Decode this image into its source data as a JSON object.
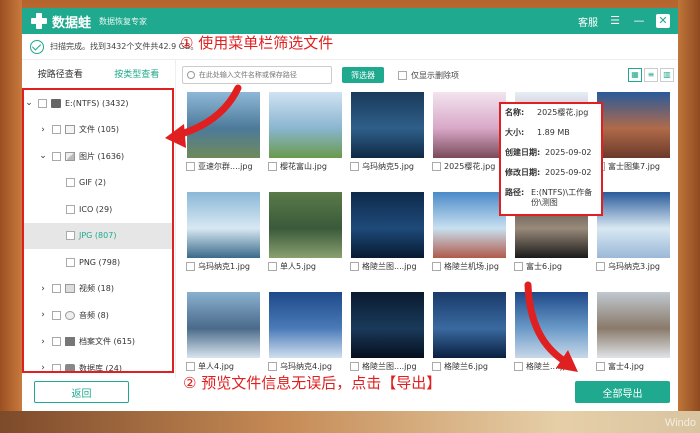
{
  "app": {
    "name": "数据蛙",
    "subtitle": "数据恢复专家",
    "support": "客服"
  },
  "status": {
    "text": "扫描完成。找到3432个文件共42.9 GB。"
  },
  "annotations": {
    "step1": "① 使用菜单栏筛选文件",
    "step2": "② 预览文件信息无误后，点击【导出】"
  },
  "sidebar": {
    "tabs": [
      {
        "label": "按路径查看"
      },
      {
        "label": "按类型查看"
      }
    ],
    "tree": [
      {
        "label": "E:(NTFS) (3432)"
      },
      {
        "label": "文件 (105)"
      },
      {
        "label": "图片 (1636)"
      },
      {
        "label": "GIF (2)"
      },
      {
        "label": "ICO (29)"
      },
      {
        "label": "JPG (807)"
      },
      {
        "label": "PNG (798)"
      },
      {
        "label": "视频 (18)"
      },
      {
        "label": "音频 (8)"
      },
      {
        "label": "档案文件 (615)"
      },
      {
        "label": "数据库 (24)"
      }
    ]
  },
  "toolbar": {
    "search_placeholder": "在此处输入文件名称或保存路径",
    "filter_label": "筛选器",
    "only_deleted_label": "仅显示删除项"
  },
  "grid": {
    "items": [
      {
        "name": "亚速尔群....jpg",
        "colors": [
          "#8fb8d8",
          "#4d7a9a",
          "#6e8a5a"
        ]
      },
      {
        "name": "樱花富山.jpg",
        "colors": [
          "#cfe3f2",
          "#8ab5d0",
          "#6a9a4a"
        ]
      },
      {
        "name": "乌玛纳克5.jpg",
        "colors": [
          "#1a3a5a",
          "#2f5f8a",
          "#0f2a45"
        ]
      },
      {
        "name": "2025樱花.jpg",
        "colors": [
          "#f2e4ee",
          "#d8a8c8",
          "#7a4a5a"
        ]
      },
      {
        "name": "2025樱花.jpg",
        "colors": [
          "#e6eef6",
          "#c0a2b8",
          "#9a6a7a"
        ]
      },
      {
        "name": "富士图集7.jpg",
        "colors": [
          "#2a5a9a",
          "#b06a4a",
          "#6a3a2a"
        ]
      },
      {
        "name": "乌玛纳克1.jpg",
        "colors": [
          "#8ab8d8",
          "#d8e8f2",
          "#3a6a8a"
        ]
      },
      {
        "name": "单人5.jpg",
        "colors": [
          "#5a7a4a",
          "#3a5a3a",
          "#8aa070"
        ]
      },
      {
        "name": "格陵兰图....jpg",
        "colors": [
          "#0e2a4a",
          "#1e4a7a",
          "#071a30"
        ]
      },
      {
        "name": "格陵兰机场.jpg",
        "colors": [
          "#4a8ac8",
          "#c8e0f0",
          "#b05a4a"
        ]
      },
      {
        "name": "富士6.jpg",
        "colors": [
          "#3a3a3a",
          "#9a8a7a",
          "#1a1a1a"
        ]
      },
      {
        "name": "乌玛纳克3.jpg",
        "colors": [
          "#2a5a9a",
          "#d8e8f2",
          "#9ab8d8"
        ]
      },
      {
        "name": "单人4.jpg",
        "colors": [
          "#8ab0d0",
          "#4a6a8a",
          "#d8e4ee"
        ]
      },
      {
        "name": "乌玛纳克4.jpg",
        "colors": [
          "#1e4a8a",
          "#4a7ab8",
          "#d0e0ee"
        ]
      },
      {
        "name": "格陵兰图....jpg",
        "colors": [
          "#0a1a30",
          "#1a3a5a",
          "#050f1e"
        ]
      },
      {
        "name": "格陵兰6.jpg",
        "colors": [
          "#1a3a6a",
          "#3a6aa0",
          "#0a1f40"
        ]
      },
      {
        "name": "格陵兰....jpg",
        "colors": [
          "#1e4a8a",
          "#6a9ac8",
          "#c8d8e8"
        ]
      },
      {
        "name": "富士4.jpg",
        "colors": [
          "#c0c8d0",
          "#8a7a6a",
          "#e0e4e8"
        ]
      }
    ]
  },
  "info": {
    "name_label": "名称:",
    "name_value": "2025樱花.jpg",
    "size_label": "大小:",
    "size_value": "1.89 MB",
    "created_label": "创建日期:",
    "created_value": "2025-09-02",
    "modified_label": "修改日期:",
    "modified_value": "2025-09-02",
    "path_label": "路径:",
    "path_value": "E:(NTFS)\\工作备份\\测图"
  },
  "bottom": {
    "back_label": "返回",
    "export_label": "全部导出"
  },
  "watermark": "Windo",
  "colors": {
    "accent": "#1fa98e",
    "annotation": "#e02020"
  }
}
